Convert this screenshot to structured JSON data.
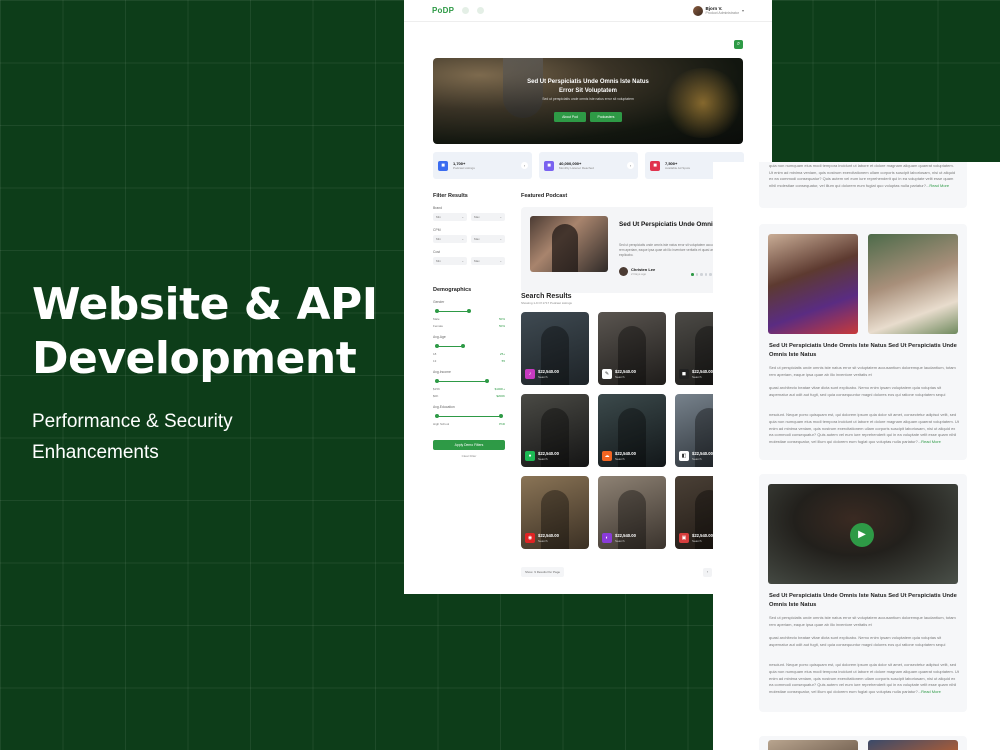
{
  "hero": {
    "title_line1": "Website & API",
    "title_line2": "Development",
    "sub_line1": "Performance & Security",
    "sub_line2": "Enhancements"
  },
  "header": {
    "logo_a": "PoD",
    "logo_b": "P",
    "user_name": "Bjorn V.",
    "user_role": "Product Administrator"
  },
  "banner": {
    "title": "Sed Ut Perspiciatis Unde Omnis Iste Natus Error Sit Voluptatem",
    "subtitle": "Sed ut perspiciatis unde omnis iste natus error sit voluptatem",
    "btn1": "About Pod",
    "btn2": "Podcasters"
  },
  "stats": [
    {
      "num": "1,700+",
      "label": "Podcast Listings",
      "color": "#3b6cf0",
      "icon": "podcast-icon"
    },
    {
      "num": "40,000,000+",
      "label": "Monthly Listener Reached",
      "color": "#7a63f0",
      "icon": "listener-icon"
    },
    {
      "num": "7,500+",
      "label": "Available Ad Spots",
      "color": "#e0334e",
      "icon": "ad-icon"
    }
  ],
  "filter": {
    "title": "Filter Results",
    "groups": [
      {
        "label": "Brand",
        "min": "Min",
        "max": "Max"
      },
      {
        "label": "CPM",
        "min": "Min",
        "max": "Max"
      },
      {
        "label": "Cost",
        "min": "Min",
        "max": "Max"
      }
    ],
    "demo_title": "Demographics",
    "demo": [
      {
        "label": "Gender",
        "rows": [
          [
            "Male",
            "50%"
          ],
          [
            "Female",
            "50%"
          ]
        ],
        "lo": 0.05,
        "hi": 0.5
      },
      {
        "label": "Avg.Age",
        "rows": [
          [
            "18",
            "25+"
          ],
          [
            "13",
            "55"
          ]
        ],
        "lo": 0.05,
        "hi": 0.42
      },
      {
        "label": "Avg.Income",
        "rows": [
          [
            "$15K",
            "$100K+"
          ],
          [
            "$0K",
            "$200K"
          ]
        ],
        "lo": 0.05,
        "hi": 0.75
      },
      {
        "label": "Avg.Education",
        "rows": [
          [
            "High School",
            "PhD"
          ]
        ],
        "lo": 0.05,
        "hi": 0.95
      }
    ],
    "apply": "Apply Demo Filters",
    "clear": "Clear Filter"
  },
  "featured": {
    "heading": "Featured Podcast",
    "title": "Sed Ut Perspiciatis Unde Omnis Iste Natus Error Sit Voluptatem",
    "desc": "Sed ut perspiciatis unde omnis iste natus error sit voluptatem accusantium doloremque laudantium, totam rem aperiam, eaque ipsa quae ab illo inventore veritatis et quasi architecto beatae vitae dicta sunt explicabo.",
    "author": "Christen Lee",
    "time": "2 Days ago"
  },
  "search": {
    "title": "Search Results",
    "subtitle": "Showing 1-9 Of 1717 Podcast Listings",
    "sort": "Sort By",
    "sort_value": "Newest",
    "tiles": [
      {
        "price": "$22,540.00",
        "cap": "Search",
        "bg": "linear-gradient(160deg,#3f4a52,#1e2428)",
        "badge": "#c63ac0",
        "glyph": "♪"
      },
      {
        "price": "$22,540.00",
        "cap": "Search",
        "bg": "linear-gradient(160deg,#5a5550,#1f1d1b)",
        "badge": "#ffffff",
        "glyph": "✎"
      },
      {
        "price": "$22,540.00",
        "cap": "Search",
        "bg": "linear-gradient(160deg,#4c4a46,#1b1a18)",
        "badge": "#222222",
        "glyph": "◼"
      },
      {
        "price": "$22,540.00",
        "cap": "Search",
        "bg": "linear-gradient(160deg,#4a4a45,#151515)",
        "badge": "#1db954",
        "glyph": "●"
      },
      {
        "price": "$22,540.00",
        "cap": "Search",
        "bg": "linear-gradient(160deg,#3c4a4c,#121719)",
        "badge": "#f26522",
        "glyph": "☁"
      },
      {
        "price": "$22,540.00",
        "cap": "Search",
        "bg": "linear-gradient(160deg,#77828c,#2a3036)",
        "badge": "#ffffff",
        "glyph": "◧"
      },
      {
        "price": "$22,540.00",
        "cap": "Search",
        "bg": "linear-gradient(160deg,#8a7456,#3b3024)",
        "badge": "#e02424",
        "glyph": "◉"
      },
      {
        "price": "$22,540.00",
        "cap": "Search",
        "bg": "linear-gradient(160deg,#8e8274,#3a332d)",
        "badge": "#8a3bd8",
        "glyph": "◐"
      },
      {
        "price": "$22,540.00",
        "cap": "Search",
        "bg": "linear-gradient(160deg,#4a4036,#1f1813)",
        "badge": "#d63d3d",
        "glyph": "▣"
      }
    ]
  },
  "pager": {
    "show": "Show",
    "per_page": "9 Results Per Page",
    "pages": [
      "‹",
      "1",
      "2",
      "3",
      "4",
      "›"
    ]
  },
  "right": {
    "card1_text": "Nemo. Neque porro quisquam est, qui dolorem ipsum quia dolor sit amet, consectetur adipisci velit, sed quia non numquam eius modi tempora incidunt ut labore et dolore magnam aliquam quaerat voluptatem. Ut enim ad minima veniam, quis nostrum exercitationem ullam corporis suscipit laboriosam, nisi ut aliquid ex ea commodi consequatur? Quis autem vel eum iure reprehenderit qui in ea voluptate velit esse quam nihil molestiae consequatur, vel illum qui dolorem eum fugiat quo voluptas nulla pariatur?...",
    "read_more": "Read More",
    "card2_title": "Sed Ut Perspiciatis Unde Omnis Iste Natus Sed Ut Perspiciatis Unde Omnis Iste Natus",
    "card2_p1": "Sed ut perspiciatis unde omnis iste natus error sit voluptatem accusantium doloremque laudantium, totam rem aperiam, eaque ipsa quae ab illo inventore veritatis et",
    "card2_p2": "quasi architecto beatae vitae dicta sunt explicabo. Nemo enim ipsam voluptatem quia voluptas sit aspernatur aut odit aut fugit, sed quia consequuntur magni dolores eos qui ratione voluptatem sequi",
    "card2_p3": "nesciunt. Neque porro quisquam est, qui dolorem ipsum quia dolor sit amet, consectetur adipisci velit, sed quia non numquam eius modi tempora incidunt ut labore et dolore magnam aliquam quaerat voluptatem. Ut enim ad minima veniam, quis nostrum exercitationem ullam corporis suscipit laboriosam, nisi ut aliquid ex ea commodi consequatur? Quis autem vel eum iure reprehenderit qui in ea voluptate velit esse quam nihil molestiae consequatur, vel illum qui dolorem eum fugiat quo voluptas nulla pariatur?...",
    "card3_title": "Sed Ut Perspiciatis Unde Omnis Iste Natus Sed Ut Perspiciatis Unde Omnis Iste Natus",
    "card3_p1": "Sed ut perspiciatis unde omnis iste natus error sit voluptatem accusantium doloremque laudantium, totam rem aperiam, eaque ipsa quae ab illo inventore veritatis et",
    "card3_p2": "quasi architecto beatae vitae dicta sunt explicabo. Nemo enim ipsam voluptatem quia voluptas sit aspernatur aut odit aut fugit, sed quia consequuntur magni dolores eos qui ratione voluptatem sequi",
    "card3_p3": "nesciunt. Neque porro quisquam est, qui dolorem ipsum quia dolor sit amet, consectetur adipisci velit, sed quia non numquam eius modi tempora incidunt ut labore et dolore magnam aliquam quaerat voluptatem. Ut enim ad minima veniam, quis nostrum exercitationem ullam corporis suscipit laboriosam, nisi ut aliquid ex ea commodi consequatur? Quis autem vel eum iure reprehenderit qui in ea voluptate velit esse quam nihil molestiae consequatur, vel illum qui dolorem eum fugiat quo voluptas nulla pariatur?..."
  }
}
